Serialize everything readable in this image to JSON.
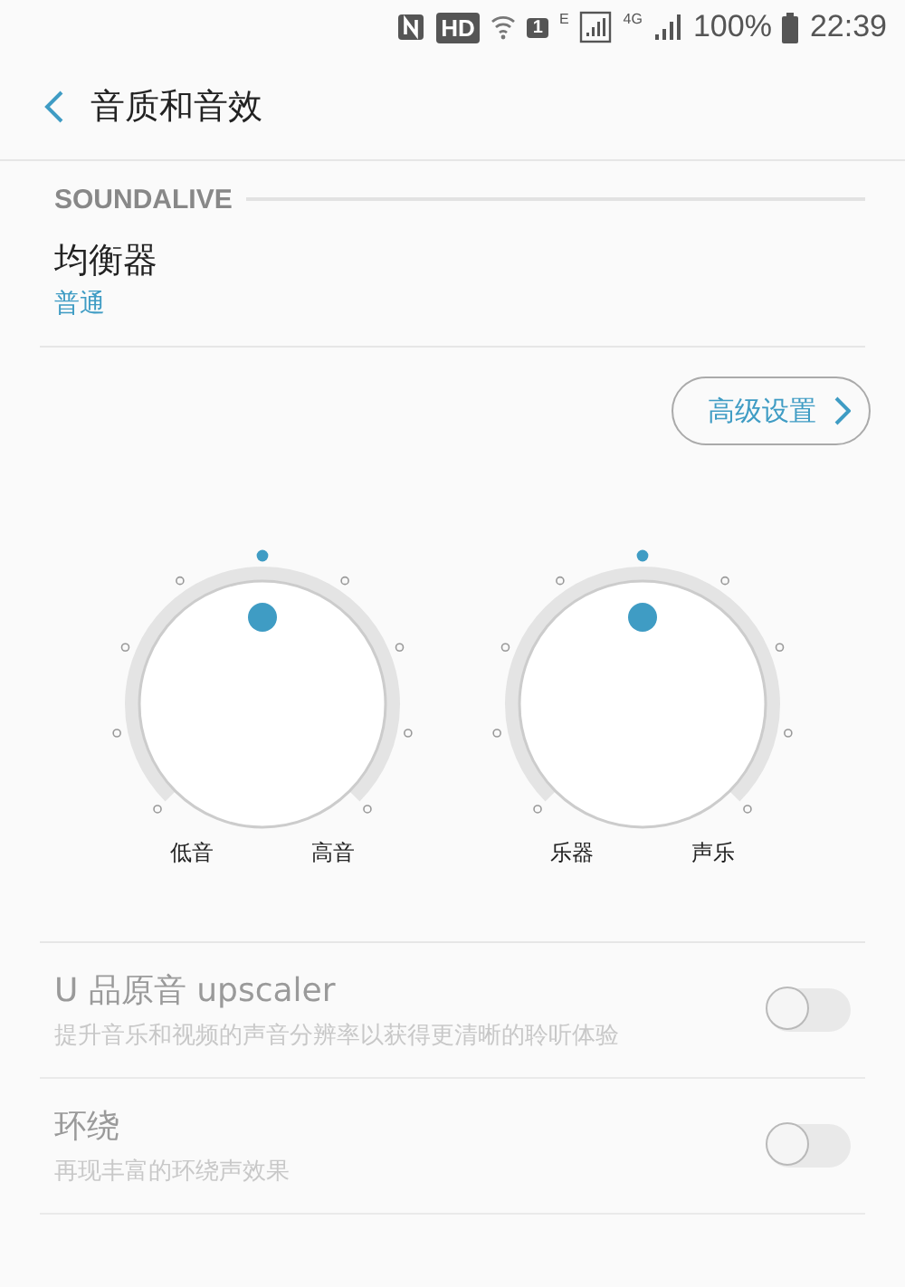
{
  "status_bar": {
    "network_labels": [
      "E",
      "4G"
    ],
    "hd": "HD",
    "sim": "1",
    "battery": "100%",
    "time": "22:39"
  },
  "app_bar": {
    "title": "音质和音效"
  },
  "section": {
    "title": "SOUNDALIVE"
  },
  "equalizer": {
    "title": "均衡器",
    "value": "普通"
  },
  "advanced_button": {
    "label": "高级设置"
  },
  "knobs": [
    {
      "left_label": "低音",
      "right_label": "高音"
    },
    {
      "left_label": "乐器",
      "right_label": "声乐"
    }
  ],
  "settings": [
    {
      "title": "U 品原音 upscaler",
      "subtitle": "提升音乐和视频的声音分辨率以获得更清晰的聆听体验",
      "on": false,
      "disabled": true
    },
    {
      "title": "环绕",
      "subtitle": "再现丰富的环绕声效果",
      "on": false,
      "disabled": true
    }
  ]
}
